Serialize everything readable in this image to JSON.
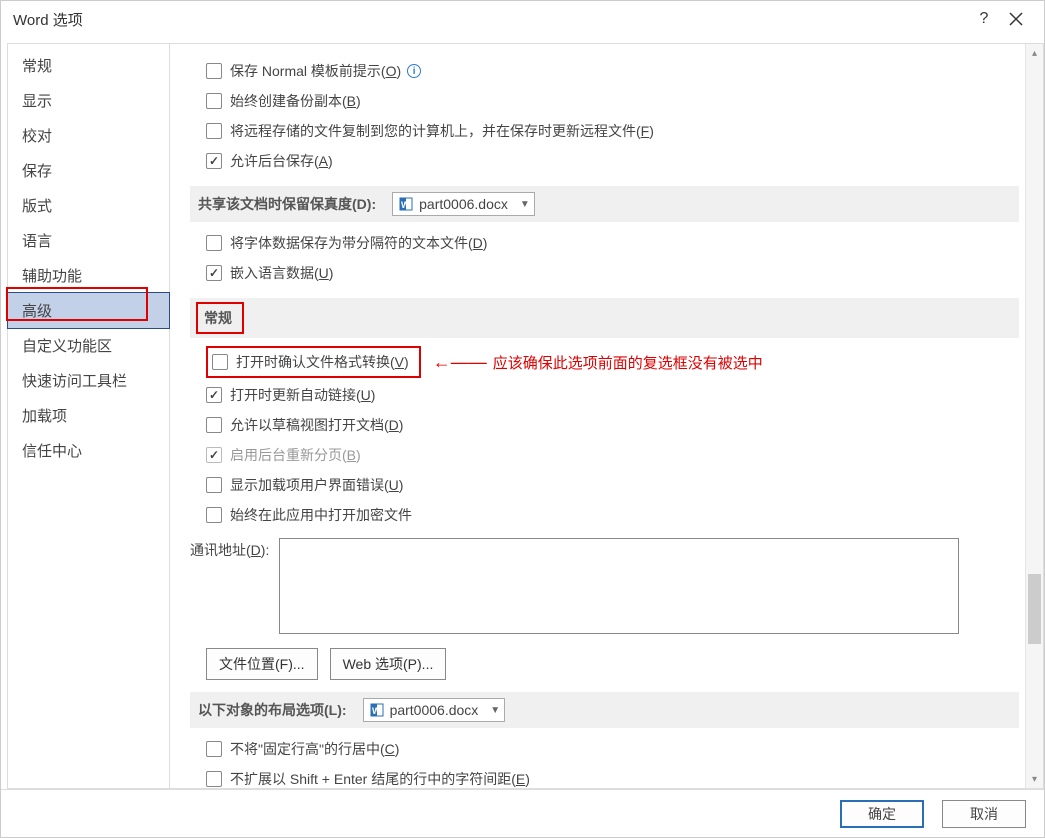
{
  "title": "Word 选项",
  "sidebar": {
    "items": [
      {
        "label": "常规"
      },
      {
        "label": "显示"
      },
      {
        "label": "校对"
      },
      {
        "label": "保存"
      },
      {
        "label": "版式"
      },
      {
        "label": "语言"
      },
      {
        "label": "辅助功能"
      },
      {
        "label": "高级"
      },
      {
        "label": "自定义功能区"
      },
      {
        "label": "快速访问工具栏"
      },
      {
        "label": "加载项"
      },
      {
        "label": "信任中心"
      }
    ],
    "selected_index": 7
  },
  "options": {
    "save_normal_prompt_pre": "保存 Normal 模板前提示(",
    "save_normal_prompt_u": "O",
    "save_normal_prompt_post": ")",
    "always_backup_pre": "始终创建备份副本(",
    "always_backup_u": "B",
    "always_backup_post": ")",
    "copy_remote_pre": "将远程存储的文件复制到您的计算机上，并在保存时更新远程文件(",
    "copy_remote_u": "F",
    "copy_remote_post": ")",
    "allow_bg_save_pre": "允许后台保存(",
    "allow_bg_save_u": "A",
    "allow_bg_save_post": ")",
    "fidelity_label_pre": "共享该文档时保留保真度(",
    "fidelity_label_u": "D",
    "fidelity_label_post": "):",
    "fidelity_doc": "part0006.docx",
    "font_as_text_pre": "将字体数据保存为带分隔符的文本文件(",
    "font_as_text_u": "D",
    "font_as_text_post": ")",
    "embed_lang_pre": "嵌入语言数据(",
    "embed_lang_u": "U",
    "embed_lang_post": ")",
    "general_header": "常规",
    "confirm_convert_pre": "打开时确认文件格式转换(",
    "confirm_convert_u": "V",
    "confirm_convert_post": ")",
    "annotation_text": "应该确保此选项前面的复选框没有被选中",
    "update_links_pre": "打开时更新自动链接(",
    "update_links_u": "U",
    "update_links_post": ")",
    "draft_view_pre": "允许以草稿视图打开文档(",
    "draft_view_u": "D",
    "draft_view_post": ")",
    "bg_repaginate_pre": "启用后台重新分页(",
    "bg_repaginate_u": "B",
    "bg_repaginate_post": ")",
    "show_addin_err_pre": "显示加载项用户界面错误(",
    "show_addin_err_u": "U",
    "show_addin_err_post": ")",
    "always_open_enc": "始终在此应用中打开加密文件",
    "mailing_addr_pre": "通讯地址(",
    "mailing_addr_u": "D",
    "mailing_addr_post": "):",
    "file_locations_pre": "文件位置(",
    "file_locations_u": "F",
    "file_locations_post": ")...",
    "web_options_pre": "Web 选项(",
    "web_options_u": "P",
    "web_options_post": ")...",
    "layout_label_pre": "以下对象的布局选项(",
    "layout_label_u": "L",
    "layout_label_post": "):",
    "layout_doc": "part0006.docx",
    "no_fixed_height_pre": "不将\"固定行高\"的行居中(",
    "no_fixed_height_u": "C",
    "no_fixed_height_post": ")",
    "no_expand_shift_pre": "不扩展以 Shift + Enter 结尾的行中的字符间距(",
    "no_expand_shift_u": "E",
    "no_expand_shift_post": ")"
  },
  "footer": {
    "ok": "确定",
    "cancel": "取消"
  }
}
